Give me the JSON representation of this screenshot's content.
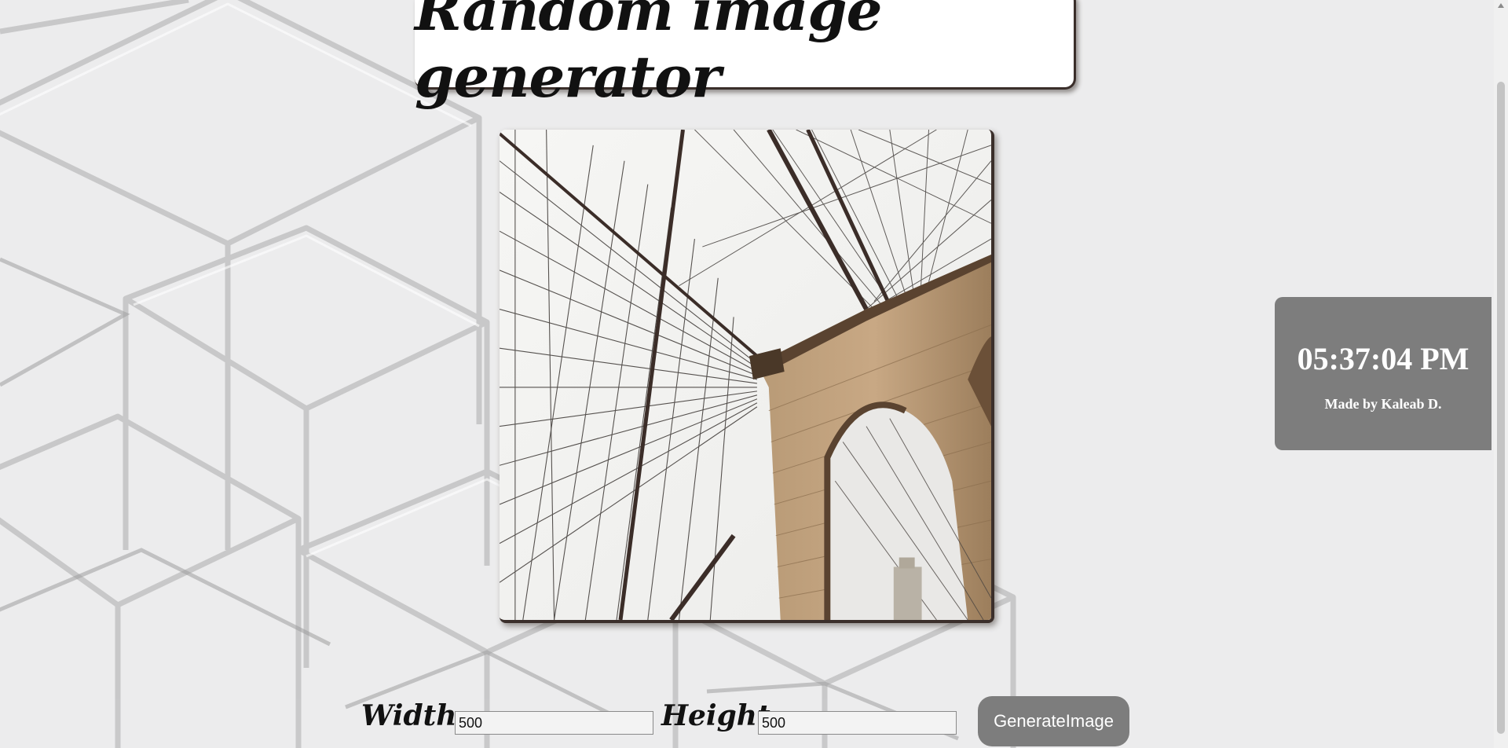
{
  "header": {
    "title": "Random image generator"
  },
  "image": {
    "subject": "Brooklyn Bridge stone tower and suspension cables viewed from below"
  },
  "clock": {
    "time": "05:37:04 PM",
    "credit": "Made by Kaleab D."
  },
  "controls": {
    "width_label": "Width:",
    "width_value": "500",
    "height_label": "Height:",
    "height_value": "500",
    "generate_label": "GenerateImage"
  },
  "colors": {
    "background": "#ececed",
    "panel": "#7d7d7d",
    "button": "#7d7d7d",
    "title_card": "#ffffff"
  }
}
